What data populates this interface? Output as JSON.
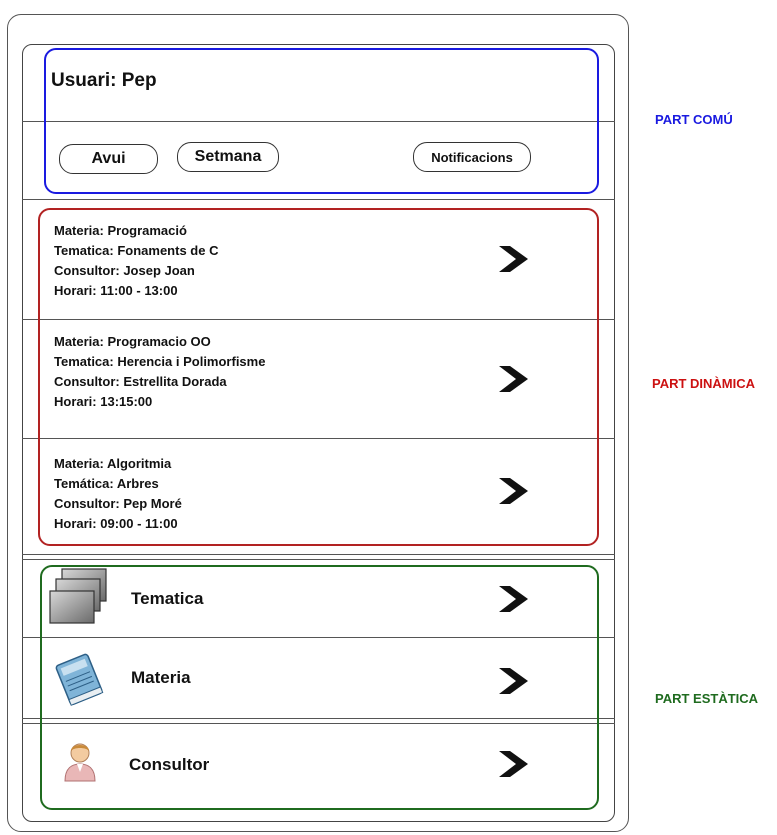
{
  "header": {
    "user_label": "Usuari: Pep",
    "buttons": {
      "today": "Avui",
      "week": "Setmana",
      "notifications": "Notificacions"
    }
  },
  "sessions": [
    {
      "materia": "Materia: Programació",
      "tematica": "Tematica: Fonaments de C",
      "consultor": "Consultor: Josep Joan",
      "horari": "Horari: 11:00 - 13:00"
    },
    {
      "materia": "Materia: Programacio OO",
      "tematica": "Tematica: Herencia i Polimorfisme",
      "consultor": "Consultor: Estrellita Dorada",
      "horari": "Horari: 13:15:00"
    },
    {
      "materia": "Materia: Algoritmia",
      "tematica": "Temática: Arbres",
      "consultor": "Consultor: Pep Moré",
      "horari": "Horari: 09:00 - 11:00"
    }
  ],
  "static_menu": {
    "items": [
      {
        "label": "Tematica",
        "icon": "stacked-layers-icon"
      },
      {
        "label": "Materia",
        "icon": "book-icon"
      },
      {
        "label": "Consultor",
        "icon": "person-icon"
      }
    ]
  },
  "annotations": {
    "common": "PART COMÚ",
    "dynamic": "PART DINÀMICA",
    "static": "PART ESTÀTICA"
  },
  "colors": {
    "common": "#1a1ae0",
    "dynamic": "#cc1111",
    "static": "#1f6b1f"
  }
}
